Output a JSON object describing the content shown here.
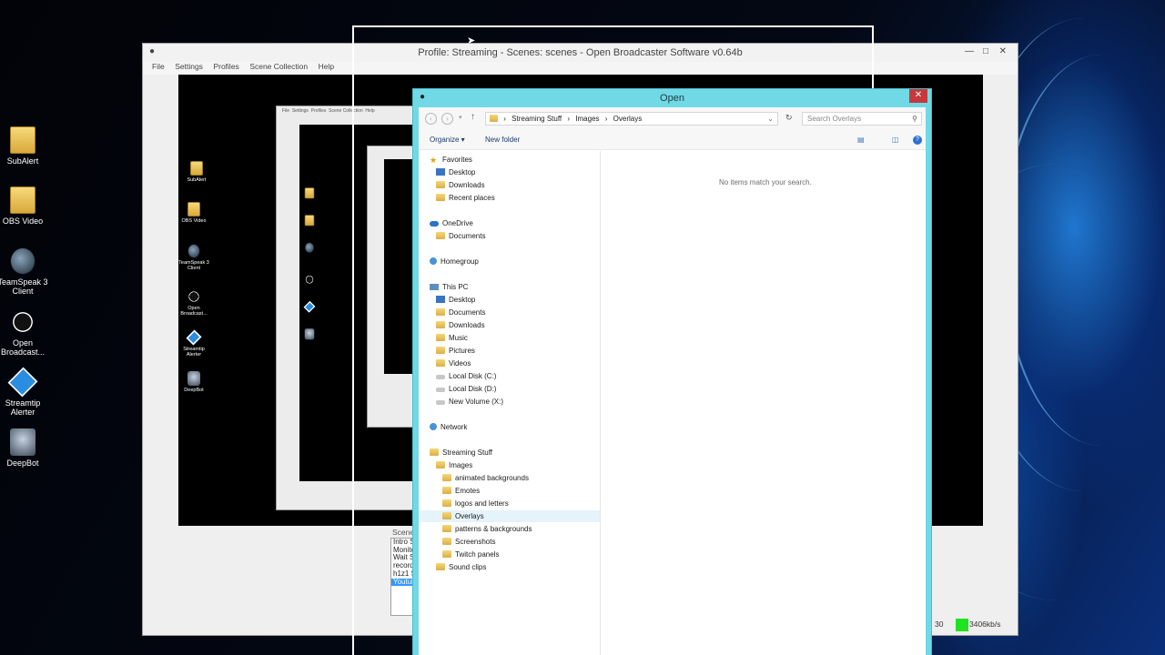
{
  "desktop": {
    "icons": [
      {
        "label": "SubAlert",
        "icon": "folder-icon"
      },
      {
        "label": "OBS Video",
        "icon": "folder-icon"
      },
      {
        "label": "TeamSpeak 3 Client",
        "icon": "teamspeak-icon"
      },
      {
        "label": "Open Broadcast...",
        "icon": "obs-icon"
      },
      {
        "label": "Streamtip Alerter",
        "icon": "streamtip-icon"
      },
      {
        "label": "DeepBot",
        "icon": "deepbot-icon"
      }
    ]
  },
  "obs": {
    "title": "Profile: Streaming - Scenes: scenes - Open Broadcaster Software v0.64b",
    "menu": [
      "File",
      "Settings",
      "Profiles",
      "Scene Collection",
      "Help"
    ],
    "scenes_label": "Scene",
    "scenes": [
      "Intro Sc",
      "Monitor",
      "Wait Sc",
      "recordi",
      "h1z1 S",
      "Youtub"
    ],
    "selected_scene_index": 5,
    "status_fps": "30",
    "bitrate": "3406kb/s",
    "status_color": "#1fe41f"
  },
  "dialog": {
    "title": "Open",
    "close": "✕",
    "breadcrumb": [
      "Streaming Stuff",
      "Images",
      "Overlays"
    ],
    "search_placeholder": "Search Overlays",
    "toolbar": {
      "organize": "Organize ▾",
      "new_folder": "New folder"
    },
    "empty_message": "No items match your search.",
    "nav": {
      "favorites": {
        "label": "Favorites",
        "items": [
          "Desktop",
          "Downloads",
          "Recent places"
        ]
      },
      "onedrive": {
        "label": "OneDrive",
        "items": [
          "Documents"
        ]
      },
      "homegroup": {
        "label": "Homegroup"
      },
      "thispc": {
        "label": "This PC",
        "items": [
          "Desktop",
          "Documents",
          "Downloads",
          "Music",
          "Pictures",
          "Videos",
          "Local Disk (C:)",
          "Local Disk (D:)",
          "New Volume (X:)"
        ]
      },
      "network": {
        "label": "Network"
      },
      "streaming": {
        "label": "Streaming Stuff",
        "images": "Images",
        "image_items": [
          "animated backgrounds",
          "Emotes",
          "logos and letters",
          "Overlays",
          "patterns & backgrounds",
          "Screenshots",
          "Twitch panels"
        ],
        "sound": "Sound clips"
      }
    },
    "selected_nav": "Overlays"
  }
}
